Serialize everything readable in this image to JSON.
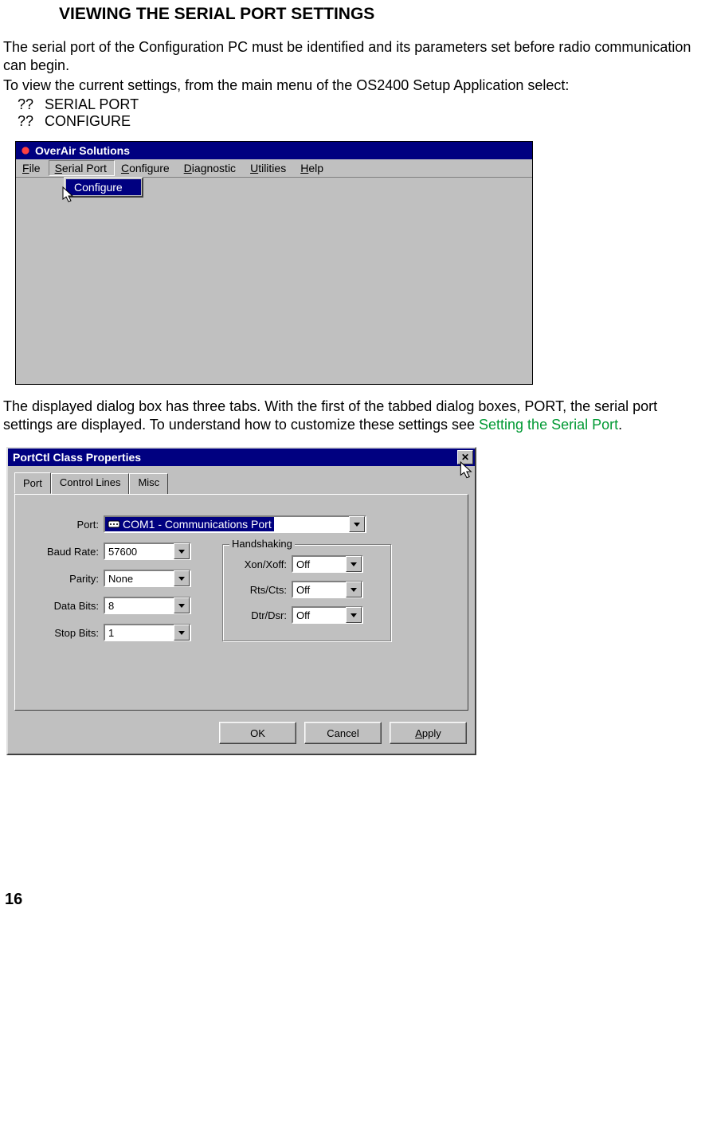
{
  "heading": "VIEWING THE SERIAL PORT SETTINGS",
  "intro_para1": "The serial port of the Configuration PC must be identified and its parameters set before radio communication can begin.",
  "intro_para2": "To view the current settings, from the main menu of the OS2400 Setup Application select:",
  "list": {
    "marker": "??",
    "items": [
      "SERIAL PORT",
      "CONFIGURE"
    ]
  },
  "mid_para_a": "The displayed dialog box has three tabs. With the first of the tabbed dialog boxes, PORT, the serial port settings are displayed.   To understand how to customize these settings see ",
  "mid_para_link": "Setting the Serial Port",
  "mid_para_b": ".",
  "page_number": "16",
  "win1": {
    "title": "OverAir Solutions",
    "menus": {
      "file": "File",
      "serial_port": "Serial Port",
      "configure": "Configure",
      "diagnostic": "Diagnostic",
      "utilities": "Utilities",
      "help": "Help"
    },
    "dropdown_item": "Configure"
  },
  "win2": {
    "title": "PortCtl Class Properties",
    "tabs": {
      "port": "Port",
      "control_lines": "Control Lines",
      "misc": "Misc"
    },
    "labels": {
      "port": "Port:",
      "baud": "Baud Rate:",
      "parity": "Parity:",
      "databits": "Data Bits:",
      "stopbits": "Stop Bits:",
      "handshaking": "Handshaking",
      "xonxoff": "Xon/Xoff:",
      "rtscts": "Rts/Cts:",
      "dtrdsr": "Dtr/Dsr:"
    },
    "values": {
      "port": "COM1 - Communications Port",
      "baud": "57600",
      "parity": "None",
      "databits": "8",
      "stopbits": "1",
      "xonxoff": "Off",
      "rtscts": "Off",
      "dtrdsr": "Off"
    },
    "buttons": {
      "ok": "OK",
      "cancel": "Cancel",
      "apply": "Apply"
    }
  }
}
